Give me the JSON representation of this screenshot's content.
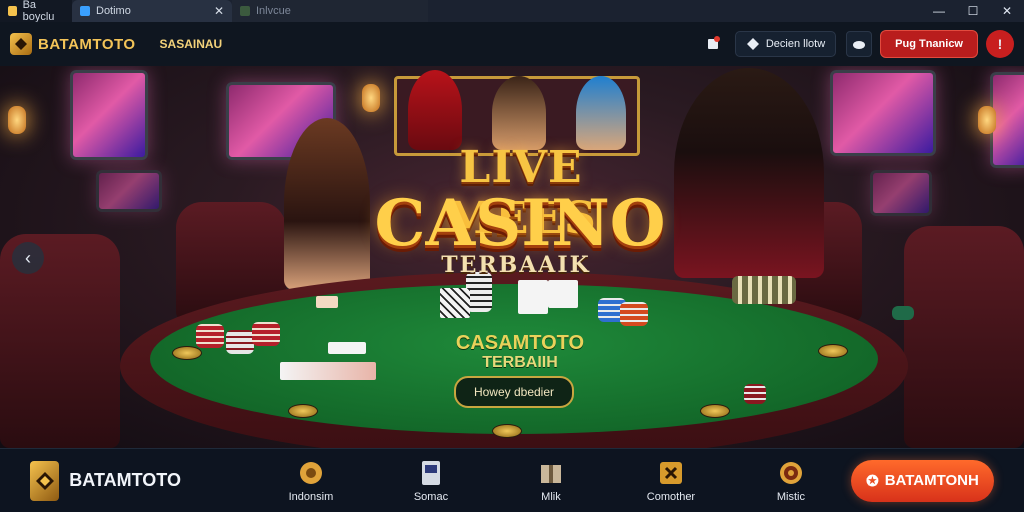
{
  "browser": {
    "app_tab_label": "Ba boyclu",
    "active_tab_label": "Dotimo",
    "inactive_tab_label": "Inlvcue"
  },
  "header": {
    "brand": "BATAMTOTO",
    "nav_link": "SASAINAU",
    "pill_dark_label": "Decien llotw",
    "pill_red_label": "Pug Tnanicw",
    "round_red_label": "!"
  },
  "hero": {
    "title_line1": "LIVE MEES",
    "title_line2": "CASINO",
    "title_line3": "TERBAAIK",
    "felt_title": "CASAMTOTO",
    "felt_subtitle": "TERBAIIH",
    "felt_button": "Howey dbedier"
  },
  "bottom": {
    "brand": "BATAMTOTO",
    "items": [
      {
        "label": "Indonsim",
        "icon": "chip-icon"
      },
      {
        "label": "Somac",
        "icon": "slot-machine-icon"
      },
      {
        "label": "Mlik",
        "icon": "box-icon"
      },
      {
        "label": "Comother",
        "icon": "trophy-icon"
      },
      {
        "label": "Mistic",
        "icon": "roulette-icon"
      }
    ],
    "cta": "BATAMTONH"
  },
  "colors": {
    "brand_gold": "#f3c458",
    "cta_orange": "#ff6a2b",
    "danger_red": "#c81f1f",
    "felt_green": "#1f8a3a"
  }
}
